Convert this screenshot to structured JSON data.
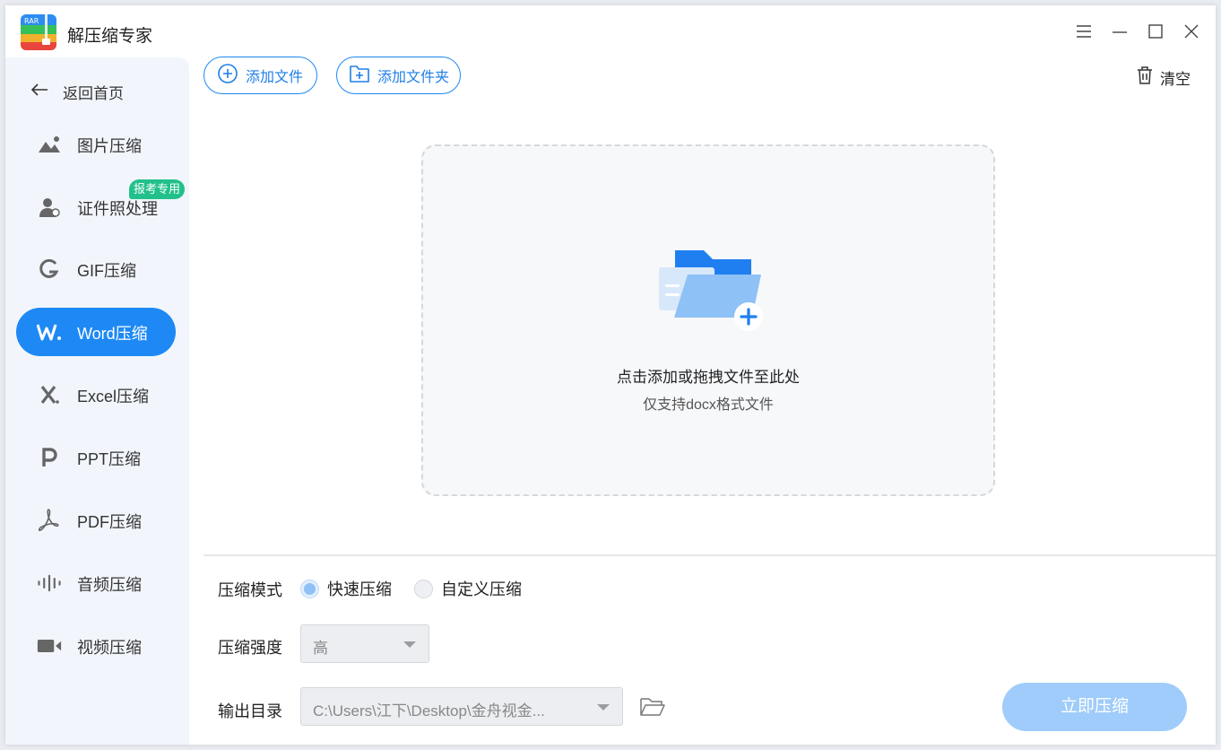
{
  "app": {
    "title": "解压缩专家",
    "logo_text": "RAR",
    "logo_colors": [
      "#2d8cf0",
      "#36c05a",
      "#f0b12d",
      "#e8453c"
    ]
  },
  "window_controls": [
    "menu-icon",
    "minimize-icon",
    "maximize-icon",
    "close-icon"
  ],
  "sidebar": {
    "back_label": "返回首页",
    "badge": "报考专用",
    "items": [
      {
        "label": "图片压缩",
        "icon": "image-icon",
        "active": false
      },
      {
        "label": "证件照处理",
        "icon": "id-photo-icon",
        "active": false
      },
      {
        "label": "GIF压缩",
        "icon": "gif-icon",
        "active": false
      },
      {
        "label": "Word压缩",
        "icon": "word-icon",
        "active": true
      },
      {
        "label": "Excel压缩",
        "icon": "excel-icon",
        "active": false
      },
      {
        "label": "PPT压缩",
        "icon": "ppt-icon",
        "active": false
      },
      {
        "label": "PDF压缩",
        "icon": "pdf-icon",
        "active": false
      },
      {
        "label": "音频压缩",
        "icon": "audio-icon",
        "active": false
      },
      {
        "label": "视频压缩",
        "icon": "video-icon",
        "active": false
      }
    ]
  },
  "toolbar": {
    "add_file": "添加文件",
    "add_folder": "添加文件夹",
    "clear": "清空"
  },
  "dropzone": {
    "title": "点击添加或拖拽文件至此处",
    "subtitle": "仅支持docx格式文件"
  },
  "settings": {
    "mode_label": "压缩模式",
    "mode_options": [
      {
        "label": "快速压缩",
        "checked": true
      },
      {
        "label": "自定义压缩",
        "checked": false
      }
    ],
    "strength_label": "压缩强度",
    "strength_value": "高",
    "output_label": "输出目录",
    "output_value": "C:\\Users\\江下\\Desktop\\金舟视金..."
  },
  "action": {
    "compress_label": "立即压缩"
  },
  "colors": {
    "accent": "#1e89f5",
    "badge": "#22c08a",
    "sidebar_bg": "#f2f6fc",
    "disabled_button": "#9fccfa"
  }
}
